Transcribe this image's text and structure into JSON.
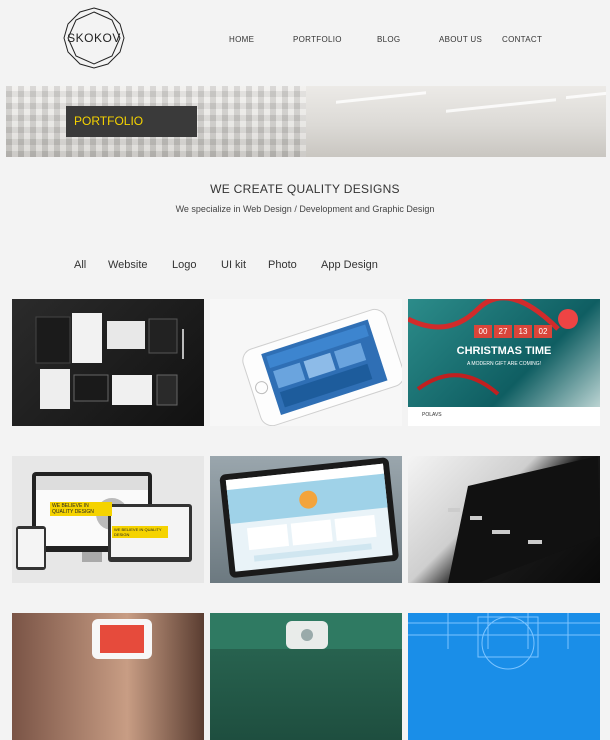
{
  "brand": {
    "logo_text": "SKOKOV"
  },
  "nav": {
    "items": [
      "HOME",
      "PORTFOLIO",
      "BLOG",
      "ABOUT US",
      "CONTACT"
    ]
  },
  "banner": {
    "title": "PORTFOLIO"
  },
  "intro": {
    "heading": "WE CREATE QUALITY DESIGNS",
    "subheading": "We specialize in Web Design / Development and Graphic Design"
  },
  "filters": [
    "All",
    "Website",
    "Logo",
    "UI kit",
    "Photo",
    "App Design"
  ],
  "colors": {
    "accent": "#f5d300",
    "label_bg": "#3a3a3a",
    "page_bg": "#f3f3f3"
  },
  "portfolio": {
    "items": [
      {
        "name": "stationery-branding"
      },
      {
        "name": "iphone-app"
      },
      {
        "name": "christmas-time-site",
        "countdown": [
          "00",
          "27",
          "13",
          "02"
        ],
        "headline": "CHRISTMAS TIME",
        "tagline": "A MODERN GIFT ARE COMING!",
        "brand": "POLAVS"
      },
      {
        "name": "responsive-devices",
        "callout_1": "WE BELIEVE IN QUALITY DESIGN",
        "callout_2": "WE BELIEVE IN QUALITY DESIGN"
      },
      {
        "name": "macbook-website"
      },
      {
        "name": "dark-monitor"
      },
      {
        "name": "hand-iphone"
      },
      {
        "name": "green-gadget"
      },
      {
        "name": "blue-icon-grid"
      }
    ]
  }
}
